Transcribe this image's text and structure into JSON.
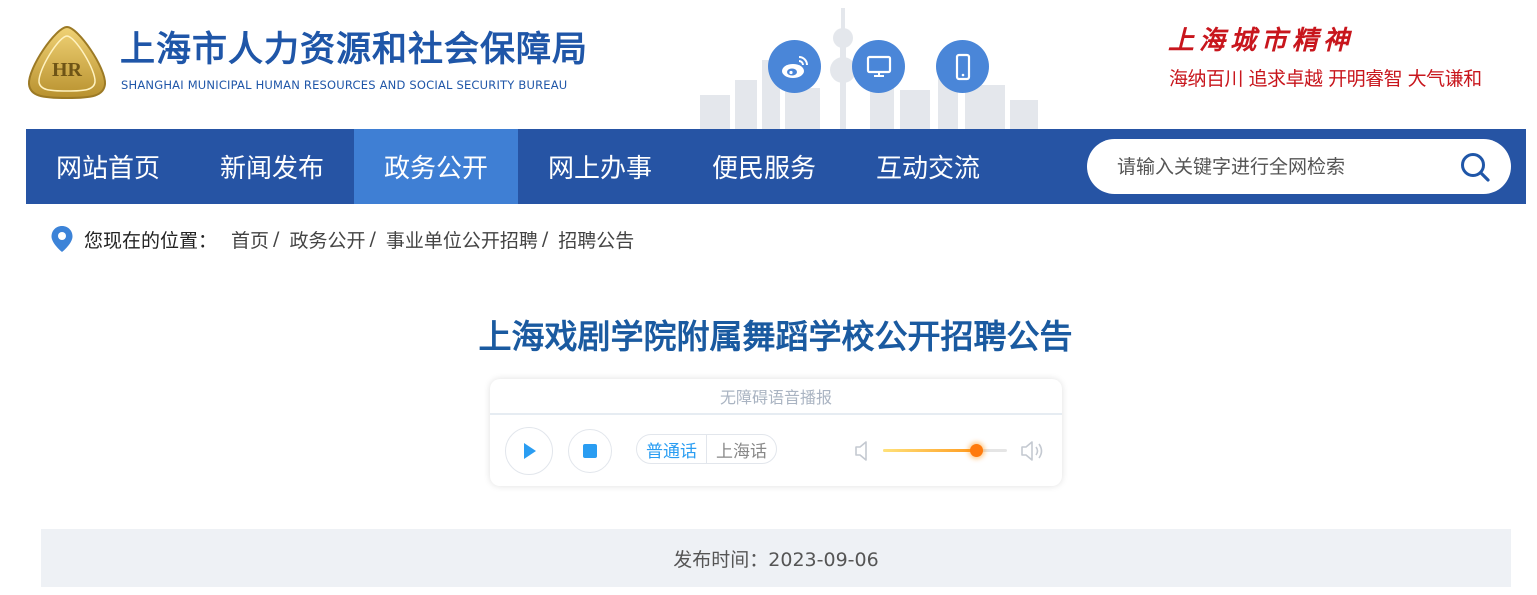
{
  "header": {
    "site_name": "上海市人力资源和社会保障局",
    "site_name_en": "SHANGHAI MUNICIPAL HUMAN RESOURCES AND SOCIAL SECURITY BUREAU",
    "icons": [
      "weibo-icon",
      "desktop-icon",
      "mobile-icon"
    ],
    "spirit_title": "上海城市精神",
    "spirit_motto": "海纳百川 追求卓越 开明睿智 大气谦和"
  },
  "nav": {
    "items": [
      {
        "label": "网站首页",
        "active": false
      },
      {
        "label": "新闻发布",
        "active": false
      },
      {
        "label": "政务公开",
        "active": true
      },
      {
        "label": "网上办事",
        "active": false
      },
      {
        "label": "便民服务",
        "active": false
      },
      {
        "label": "互动交流",
        "active": false
      }
    ],
    "search_placeholder": "请输入关键字进行全网检索"
  },
  "breadcrumb": {
    "label": "您现在的位置：",
    "items": [
      "首页",
      "政务公开",
      "事业单位公开招聘",
      "招聘公告"
    ],
    "separator": "/"
  },
  "article": {
    "title": "上海戏剧学院附属舞蹈学校公开招聘公告",
    "publish": "发布时间：2023-09-06"
  },
  "player": {
    "header": "无障碍语音播报",
    "dialects": [
      "普通话",
      "上海话"
    ],
    "selected_dialect": "普通话",
    "volume": 0.75
  },
  "colors": {
    "brand_blue": "#2654a4",
    "nav_active": "#3f7fd4",
    "title_blue": "#1a5aa0",
    "spirit_red": "#c8161d",
    "icon_blue": "#4a86d8",
    "player_accent": "#2a9df2",
    "volume_orange": "#ff7a0d"
  }
}
